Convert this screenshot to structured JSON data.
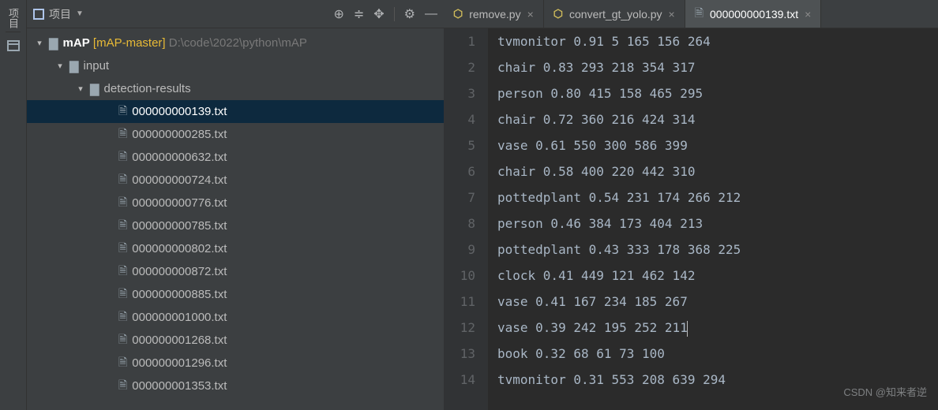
{
  "left_margin": {
    "label": "项目"
  },
  "sidebar": {
    "header_title": "项目",
    "root": {
      "name": "mAP",
      "bracket": "[mAP-master]",
      "path": "D:\\code\\2022\\python\\mAP"
    },
    "folder_input": "input",
    "folder_detection": "detection-results",
    "files": [
      "000000000139.txt",
      "000000000285.txt",
      "000000000632.txt",
      "000000000724.txt",
      "000000000776.txt",
      "000000000785.txt",
      "000000000802.txt",
      "000000000872.txt",
      "000000000885.txt",
      "000000001000.txt",
      "000000001268.txt",
      "000000001296.txt",
      "000000001353.txt"
    ],
    "selected_index": 0
  },
  "tabs": [
    {
      "label": "remove.py",
      "type": "py",
      "active": false
    },
    {
      "label": "convert_gt_yolo.py",
      "type": "py",
      "active": false
    },
    {
      "label": "000000000139.txt",
      "type": "txt",
      "active": true
    }
  ],
  "editor": {
    "lines": [
      "tvmonitor 0.91 5 165 156 264",
      "chair 0.83 293 218 354 317",
      "person 0.80 415 158 465 295",
      "chair 0.72 360 216 424 314",
      "vase 0.61 550 300 586 399",
      "chair 0.58 400 220 442 310",
      "pottedplant 0.54 231 174 266 212",
      "person 0.46 384 173 404 213",
      "pottedplant 0.43 333 178 368 225",
      "clock 0.41 449 121 462 142",
      "vase 0.41 167 234 185 267",
      "vase 0.39 242 195 252 211",
      "book 0.32 68 61 73 100",
      "tvmonitor 0.31 553 208 639 294"
    ],
    "caret_line": 12
  },
  "watermark": "CSDN @知来者逆"
}
